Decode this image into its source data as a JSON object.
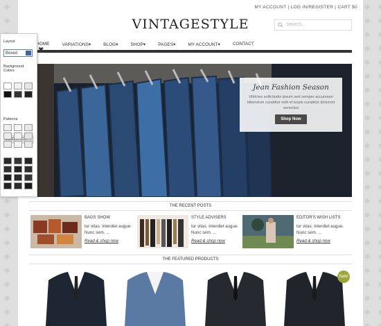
{
  "header": {
    "account_links": "MY ACCOUNT | LOG IN/REGISTER | CART $0",
    "logo": "VINTAGESTYLE",
    "search_placeholder": "Search..."
  },
  "nav": {
    "items": [
      "HOME",
      "VARIATIONS",
      "BLOG",
      "SHOP",
      "PAGES",
      "MY ACCOUNT",
      "CONTACT"
    ]
  },
  "hero": {
    "title": "Jean Fashion Season",
    "description": "Ultricies sollicitudin ipsum sed semper accumsan bibendum curabitur velit et turpis curabitur dictumst senectus",
    "button": "Shop Now"
  },
  "recent_posts": {
    "heading": "THE RECENT POSTS",
    "posts": [
      {
        "title": "BAGS SHOW",
        "excerpt": "tur vitas. Interdiet augue. Nunc sem. ...",
        "link": "Read & shop now"
      },
      {
        "title": "STYLE ADVISERS",
        "excerpt": "tur vitas. Interdiet augue. Nunc sem. ...",
        "link": "Read & shop now"
      },
      {
        "title": "EDITOR'S WISH LISTS",
        "excerpt": "tur vitas. Interdiet augue. Nunc sem. ...",
        "link": "Read & shop now"
      }
    ]
  },
  "featured": {
    "heading": "THE FEATURED PRODUCTS",
    "sale_badge": "Sale!"
  },
  "style_panel": {
    "layout_label": "Layout",
    "layout_value": "Boxed",
    "bg_label": "Background Colors",
    "color_pick": "COLOR PICK",
    "patterns_label": "Patterns"
  },
  "colors": {
    "accent": "#333333",
    "sale": "#9aa83a",
    "panel_select": "#3d63a8"
  }
}
